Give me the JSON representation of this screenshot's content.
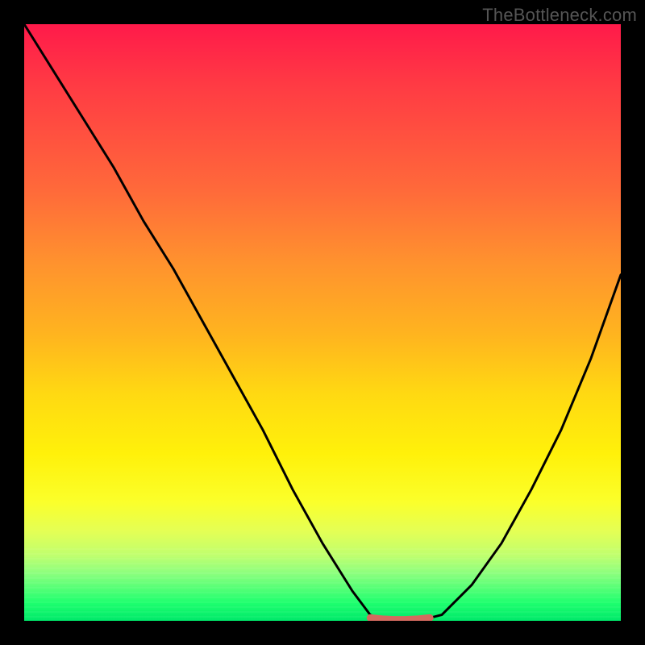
{
  "watermark": "TheBottleneck.com",
  "colors": {
    "curve": "#000000",
    "minimum_dot": "#d46a5f",
    "plot_border": "#000000"
  },
  "chart_data": {
    "type": "line",
    "title": "",
    "xlabel": "",
    "ylabel": "",
    "xlim": [
      0,
      1
    ],
    "ylim": [
      0,
      1
    ],
    "background": "red-yellow-green vertical gradient (high=red top, low=green bottom)",
    "series": [
      {
        "name": "bottleneck-curve",
        "x": [
          0.0,
          0.05,
          0.1,
          0.15,
          0.2,
          0.25,
          0.3,
          0.35,
          0.4,
          0.45,
          0.5,
          0.55,
          0.58,
          0.6,
          0.63,
          0.66,
          0.7,
          0.75,
          0.8,
          0.85,
          0.9,
          0.95,
          1.0
        ],
        "y": [
          1.0,
          0.92,
          0.84,
          0.76,
          0.67,
          0.59,
          0.5,
          0.41,
          0.32,
          0.22,
          0.13,
          0.05,
          0.01,
          0.0,
          0.0,
          0.0,
          0.01,
          0.06,
          0.13,
          0.22,
          0.32,
          0.44,
          0.58
        ]
      },
      {
        "name": "minimum-highlight",
        "x": [
          0.58,
          0.6,
          0.62,
          0.64,
          0.66,
          0.68
        ],
        "y": [
          0.005,
          0.003,
          0.002,
          0.002,
          0.003,
          0.005
        ]
      }
    ],
    "annotations": []
  }
}
